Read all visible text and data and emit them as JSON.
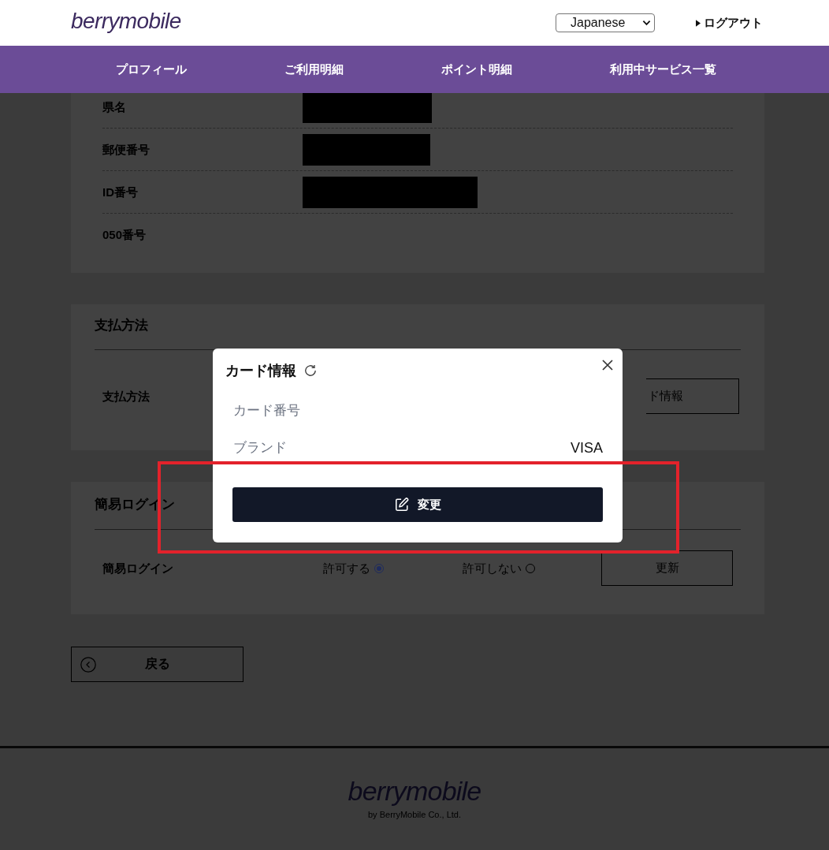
{
  "header": {
    "logo": "berrymobile",
    "language_select": {
      "value": "Japanese"
    },
    "logout": {
      "label": "ログアウト"
    }
  },
  "nav": [
    "プロフィール",
    "ご利用明細",
    "ポイント明細",
    "利用中サービス一覧"
  ],
  "profile": {
    "rows": [
      {
        "label": "県名",
        "redacted": true
      },
      {
        "label": "郵便番号",
        "redacted": true
      },
      {
        "label": "ID番号",
        "redacted": true
      },
      {
        "label": "050番号",
        "redacted": false
      }
    ]
  },
  "payment": {
    "title": "支払方法",
    "label": "支払方法",
    "button": "ド情報"
  },
  "quick_login": {
    "title": "簡易ログイン",
    "label": "簡易ログイン",
    "options": [
      {
        "label": "許可する",
        "selected": true
      },
      {
        "label": "許可しない",
        "selected": false
      }
    ],
    "button": "更新"
  },
  "back_button": {
    "label": "戻る"
  },
  "footer": {
    "logo": "berrymobile",
    "copyright": "by BerryMobile Co., Ltd."
  },
  "modal": {
    "title": "カード情報",
    "rows": [
      {
        "label": "カード番号"
      },
      {
        "label": "ブランド",
        "value": "VISA"
      }
    ],
    "button": "変更"
  }
}
